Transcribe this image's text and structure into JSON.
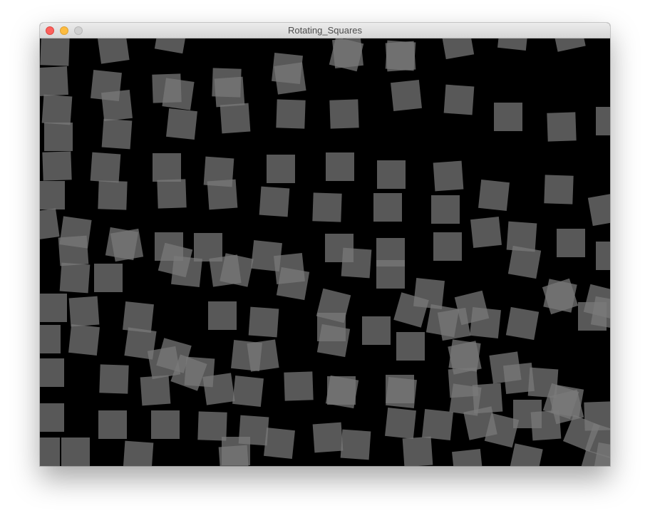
{
  "window": {
    "title": "Rotating_Squares"
  },
  "titlebar": {
    "buttons": [
      "close",
      "minimize",
      "zoom"
    ]
  },
  "canvas": {
    "background": "#000000",
    "square_fill": "#7a7a7a",
    "square_opacity": 0.72
  }
}
